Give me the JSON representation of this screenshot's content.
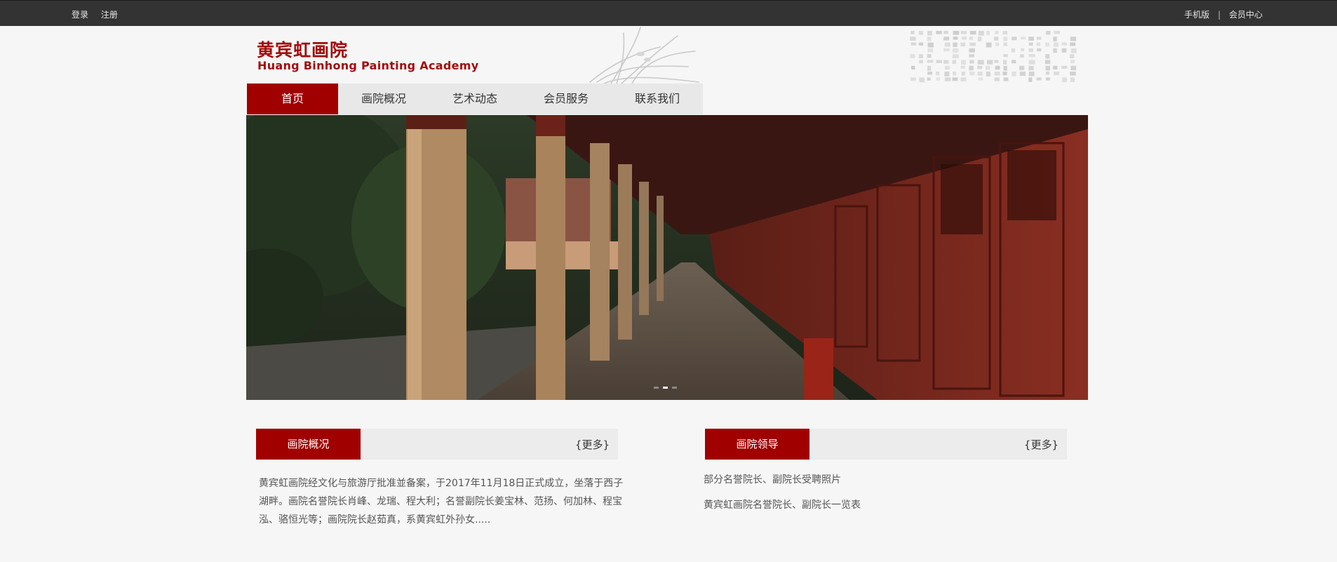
{
  "topbar": {
    "login": "登录",
    "register": "注册",
    "mobile": "手机版",
    "separator": "|",
    "member_center": "会员中心"
  },
  "header": {
    "logo_cn": "黄宾虹画院",
    "logo_en": "Huang Binhong Painting Academy"
  },
  "nav": {
    "items": [
      {
        "label": "首页"
      },
      {
        "label": "画院概况"
      },
      {
        "label": "艺术动态"
      },
      {
        "label": "会员服务"
      },
      {
        "label": "联系我们"
      }
    ]
  },
  "about": {
    "title": "画院概况",
    "more": "{更多}",
    "text": "黄宾虹画院经文化与旅游厅批准並备案，于2017年11月18日正式成立，坐落于西子湖畔。画院名誉院长肖峰、龙瑞、程大利；名誉副院长姜宝林、范扬、何加林、程宝泓、骆恒光等；画院院长赵茹真，系黄宾虹外孙女....."
  },
  "leaders": {
    "title": "画院领导",
    "more": "{更多}",
    "items": [
      {
        "label": "部分名誉院长、副院长受聘照片"
      },
      {
        "label": "黄宾虹画院名誉院长、副院长一览表"
      }
    ]
  },
  "colors": {
    "brand_red": "#a00000",
    "topbar": "#333333"
  }
}
